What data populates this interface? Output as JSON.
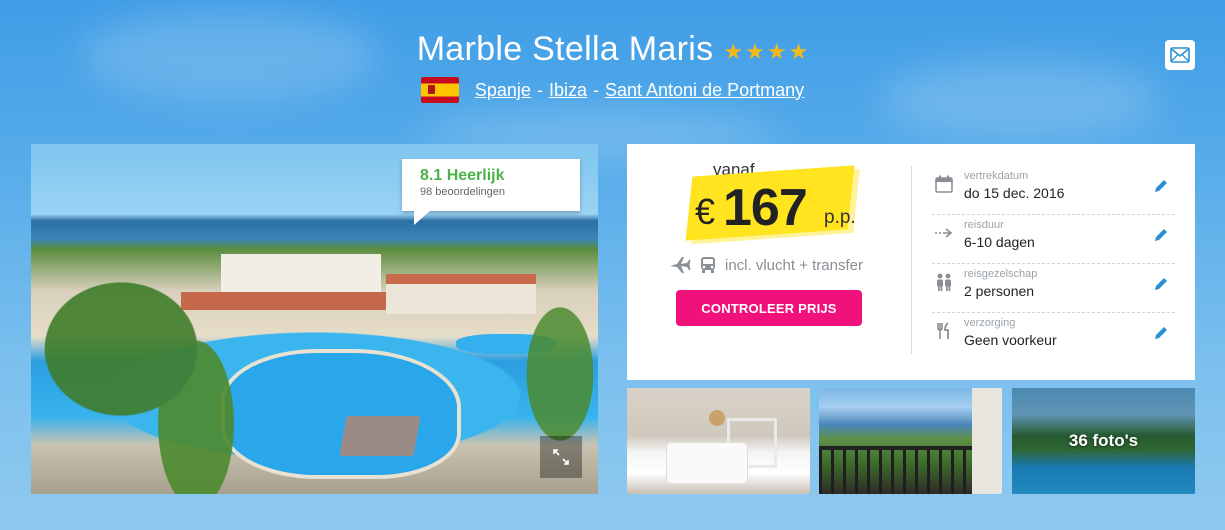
{
  "hotel": {
    "name": "Marble Stella Maris",
    "stars": 4
  },
  "location": {
    "country": "Spanje",
    "island": "Ibiza",
    "town": "Sant Antoni de Portmany",
    "separator": "-"
  },
  "rating": {
    "score": "8.1 Heerlijk",
    "reviews": "98 beoordelingen"
  },
  "price": {
    "from_label": "vanaf",
    "currency": "€",
    "amount": "167",
    "per_person": "p.p.",
    "includes": "incl. vlucht + transfer",
    "cta_label": "CONTROLEER PRIJS"
  },
  "details": [
    {
      "label": "vertrekdatum",
      "value": "do 15 dec. 2016",
      "icon": "calendar-icon"
    },
    {
      "label": "reisduur",
      "value": "6-10 dagen",
      "icon": "duration-arrow-icon"
    },
    {
      "label": "reisgezelschap",
      "value": "2 personen",
      "icon": "people-icon"
    },
    {
      "label": "verzorging",
      "value": "Geen voorkeur",
      "icon": "cutlery-icon"
    }
  ],
  "gallery": {
    "photo_count_label": "36 foto's"
  },
  "colors": {
    "accent_pink": "#f0127a",
    "price_highlight": "#ffe41f",
    "rating_green": "#4db04a",
    "star_gold": "#f5b81b",
    "edit_blue": "#2b8fd6"
  }
}
